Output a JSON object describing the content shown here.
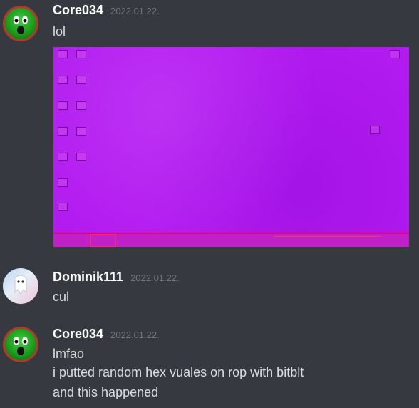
{
  "messages": [
    {
      "author": "Core034",
      "timestamp": "2022.01.22.",
      "lines": [
        "lol"
      ],
      "avatar": "green-face-avatar",
      "has_attachment": true
    },
    {
      "author": "Dominik111",
      "timestamp": "2022.01.22.",
      "lines": [
        "cul"
      ],
      "avatar": "ghost-avatar"
    },
    {
      "author": "Core034",
      "timestamp": "2022.01.22.",
      "lines": [
        "lmfao",
        "i putted random  hex vuales on rop with bitblt",
        "and this happened"
      ],
      "avatar": "green-face-avatar"
    }
  ],
  "colors": {
    "background": "#36393f",
    "username": "#ffffff",
    "timestamp": "#72767d",
    "message_text": "#dcddde",
    "attachment_tint": "#b21af0"
  }
}
